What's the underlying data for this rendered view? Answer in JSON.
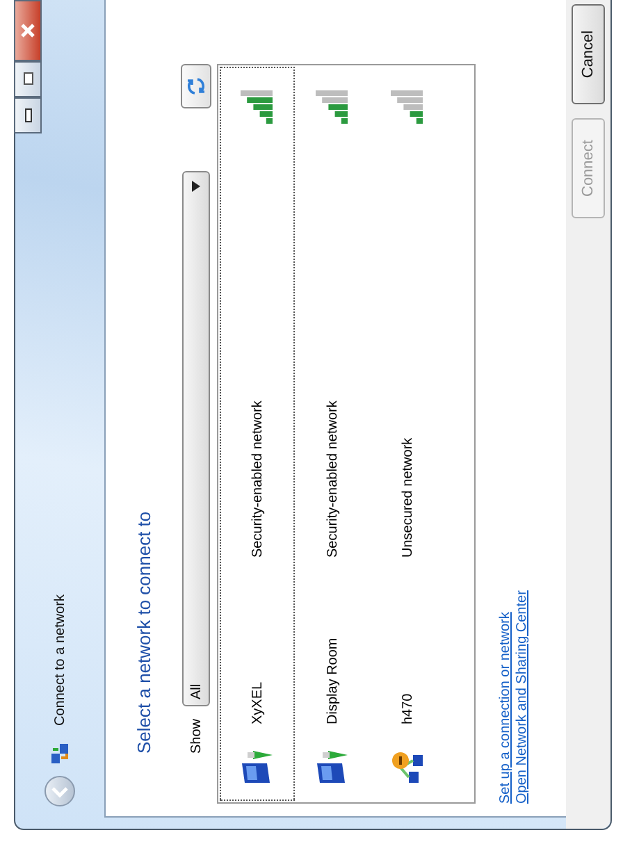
{
  "window": {
    "title": "Connect to a network"
  },
  "heading": "Select a network to connect to",
  "filter": {
    "label": "Show",
    "value": "All"
  },
  "networks": [
    {
      "name": "XyXEL",
      "status": "Security-enabled network",
      "kind": "secured",
      "level": 0.8,
      "selected": true
    },
    {
      "name": "Display Room",
      "status": "Security-enabled network",
      "kind": "secured",
      "level": 0.6,
      "selected": false
    },
    {
      "name": "h470",
      "status": "Unsecured network",
      "kind": "unsecured",
      "level": 0.4,
      "selected": false
    }
  ],
  "links": [
    "Set up a connection or network",
    "Open Network and Sharing Center"
  ],
  "buttons": [
    {
      "label": "Connect",
      "disabled": true
    },
    {
      "label": "Cancel",
      "disabled": false
    }
  ]
}
